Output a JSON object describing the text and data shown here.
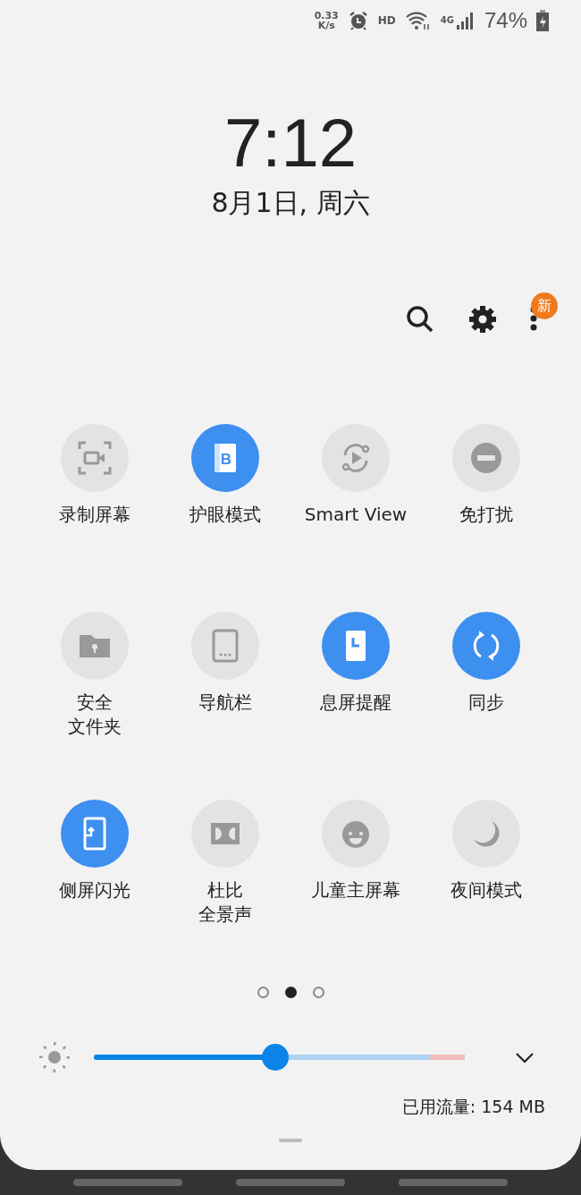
{
  "status_bar": {
    "speed_value": "0.33",
    "speed_unit": "K/s",
    "hd": "HD",
    "network": "4G",
    "battery_percent": "74%"
  },
  "clock": {
    "time": "7:12",
    "date": "8月1日, 周六"
  },
  "toolbar": {
    "badge": "新"
  },
  "tiles": [
    {
      "kind": "screen-record",
      "label": "录制屏幕",
      "on": false
    },
    {
      "kind": "eye-comfort",
      "label": "护眼模式",
      "on": true,
      "glyph": "B"
    },
    {
      "kind": "smart-view",
      "label": "Smart View",
      "on": false
    },
    {
      "kind": "do-not-disturb",
      "label": "免打扰",
      "on": false
    },
    {
      "kind": "secure-folder",
      "label": [
        "安全",
        "文件夹"
      ],
      "on": false
    },
    {
      "kind": "navigation-bar",
      "label": "导航栏",
      "on": false
    },
    {
      "kind": "always-on",
      "label": "息屏提醒",
      "on": true
    },
    {
      "kind": "sync",
      "label": "同步",
      "on": true
    },
    {
      "kind": "edge-lighting",
      "label": "侧屏闪光",
      "on": true
    },
    {
      "kind": "dolby",
      "label": [
        "杜比",
        "全景声"
      ],
      "on": false
    },
    {
      "kind": "kids-home",
      "label": "儿童主屏幕",
      "on": false
    },
    {
      "kind": "night-mode",
      "label": "夜间模式",
      "on": false
    }
  ],
  "pages": [
    {
      "selected": false
    },
    {
      "selected": true
    },
    {
      "selected": false
    }
  ],
  "brightness": {
    "level": 0.49
  },
  "data_usage": "已用流量: 154 MB"
}
